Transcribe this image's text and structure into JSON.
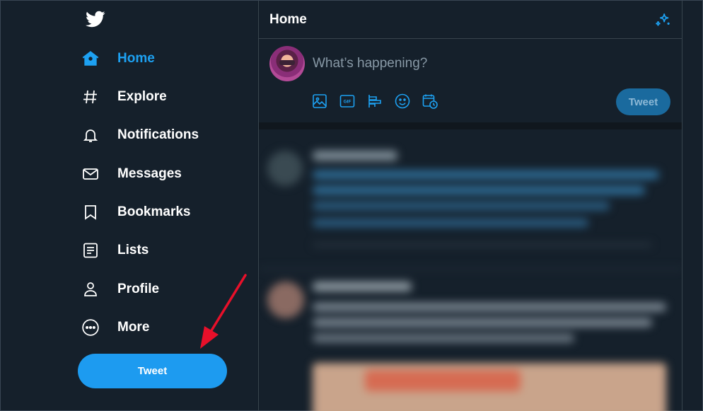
{
  "colors": {
    "background": "#15202b",
    "accent": "#1da1f2",
    "text": "#ffffff",
    "muted": "#8899a6",
    "annotation_arrow": "#e8102a"
  },
  "sidebar": {
    "logo_icon": "twitter-bird-icon",
    "items": [
      {
        "label": "Home",
        "icon": "home-icon",
        "active": true
      },
      {
        "label": "Explore",
        "icon": "hashtag-icon",
        "active": false
      },
      {
        "label": "Notifications",
        "icon": "bell-icon",
        "active": false
      },
      {
        "label": "Messages",
        "icon": "envelope-icon",
        "active": false
      },
      {
        "label": "Bookmarks",
        "icon": "bookmark-icon",
        "active": false
      },
      {
        "label": "Lists",
        "icon": "list-icon",
        "active": false
      },
      {
        "label": "Profile",
        "icon": "person-icon",
        "active": false
      },
      {
        "label": "More",
        "icon": "more-circle-icon",
        "active": false
      }
    ],
    "tweet_button": "Tweet"
  },
  "header": {
    "title": "Home",
    "sparkle_icon": "sparkle-icon"
  },
  "composer": {
    "placeholder": "What’s happening?",
    "tools": [
      "image-icon",
      "gif-icon",
      "poll-icon",
      "emoji-icon",
      "schedule-icon"
    ],
    "tweet_button": "Tweet"
  }
}
